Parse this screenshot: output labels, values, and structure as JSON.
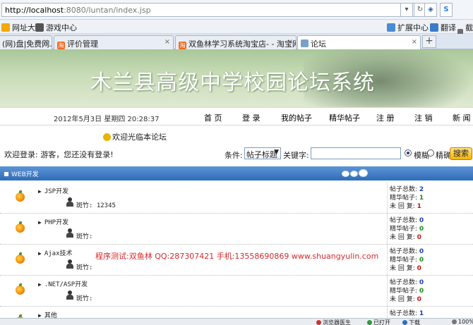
{
  "browser": {
    "url_host": "http://localhost",
    "url_rest": ":8080/luntan/index.jsp",
    "bookmarks": [
      "网址大全",
      "游戏中心"
    ],
    "toolbar": [
      "扩展中心",
      "翻译",
      "截图"
    ],
    "tabs": [
      {
        "title": "(网)盘|免费网...",
        "active": false
      },
      {
        "title": "评价管理",
        "active": false
      },
      {
        "title": "双鱼林学习系统淘宝店- - 淘宝网",
        "active": false
      },
      {
        "title": "论坛",
        "active": true
      }
    ]
  },
  "banner": {
    "title": "木兰县高级中学校园论坛系统"
  },
  "nav": {
    "date": "2012年5月3日 星期四 20:28:37",
    "items": [
      "首 页",
      "登 录",
      "我的帖子",
      "精华帖子",
      "注 册",
      "注 销",
      "新 闻"
    ]
  },
  "welcome": {
    "text": "欢迎光临本论坛"
  },
  "search": {
    "login_status": "欢迎登录: 游客，您还没有登录!",
    "condition_label": "条件:",
    "condition_value": "帖子标题",
    "keyword_label": "关键字:",
    "keyword_value": "",
    "radio_fuzzy": "模糊",
    "radio_exact": "精确",
    "button": "搜索"
  },
  "section": {
    "title": "WEB开发"
  },
  "boards": [
    {
      "name": "JSP开发",
      "moderator_label": "斑竹:",
      "moderator": "12345",
      "posts": "2",
      "elite": "1",
      "unreplied": "1"
    },
    {
      "name": "PHP开发",
      "moderator_label": "斑竹:",
      "moderator": "",
      "posts": "0",
      "elite": "0",
      "unreplied": "0"
    },
    {
      "name": "Ajax技术",
      "moderator_label": "斑竹:",
      "moderator": "",
      "posts": "0",
      "elite": "0",
      "unreplied": "0"
    },
    {
      "name": ".NET/ASP开发",
      "moderator_label": "斑竹:",
      "moderator": "",
      "posts": "0",
      "elite": "0",
      "unreplied": "0"
    },
    {
      "name": "其他",
      "moderator_label": "",
      "moderator": "",
      "posts": "1",
      "elite": "",
      "unreplied": ""
    }
  ],
  "stat_labels": {
    "posts": "帖子总数:",
    "elite": "精华帖子:",
    "unreplied": "未 回 复:"
  },
  "watermark": "程序测试:双鱼林 QQ:287307421 手机:13558690869 www.shuangyulin.com",
  "statusbar": [
    "浏览器医生",
    "已打开",
    "下载",
    "100%"
  ]
}
